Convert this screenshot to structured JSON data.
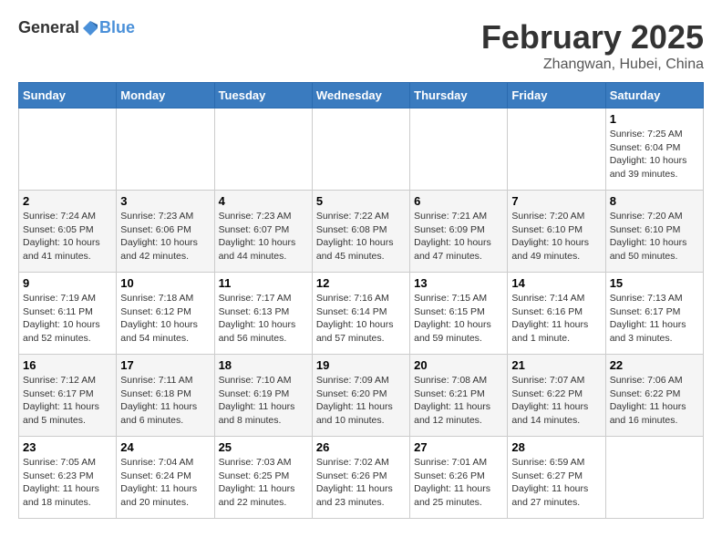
{
  "header": {
    "logo_general": "General",
    "logo_blue": "Blue",
    "month": "February 2025",
    "location": "Zhangwan, Hubei, China"
  },
  "days_of_week": [
    "Sunday",
    "Monday",
    "Tuesday",
    "Wednesday",
    "Thursday",
    "Friday",
    "Saturday"
  ],
  "weeks": [
    [
      {
        "day": "",
        "info": ""
      },
      {
        "day": "",
        "info": ""
      },
      {
        "day": "",
        "info": ""
      },
      {
        "day": "",
        "info": ""
      },
      {
        "day": "",
        "info": ""
      },
      {
        "day": "",
        "info": ""
      },
      {
        "day": "1",
        "info": "Sunrise: 7:25 AM\nSunset: 6:04 PM\nDaylight: 10 hours\nand 39 minutes."
      }
    ],
    [
      {
        "day": "2",
        "info": "Sunrise: 7:24 AM\nSunset: 6:05 PM\nDaylight: 10 hours\nand 41 minutes."
      },
      {
        "day": "3",
        "info": "Sunrise: 7:23 AM\nSunset: 6:06 PM\nDaylight: 10 hours\nand 42 minutes."
      },
      {
        "day": "4",
        "info": "Sunrise: 7:23 AM\nSunset: 6:07 PM\nDaylight: 10 hours\nand 44 minutes."
      },
      {
        "day": "5",
        "info": "Sunrise: 7:22 AM\nSunset: 6:08 PM\nDaylight: 10 hours\nand 45 minutes."
      },
      {
        "day": "6",
        "info": "Sunrise: 7:21 AM\nSunset: 6:09 PM\nDaylight: 10 hours\nand 47 minutes."
      },
      {
        "day": "7",
        "info": "Sunrise: 7:20 AM\nSunset: 6:10 PM\nDaylight: 10 hours\nand 49 minutes."
      },
      {
        "day": "8",
        "info": "Sunrise: 7:20 AM\nSunset: 6:10 PM\nDaylight: 10 hours\nand 50 minutes."
      }
    ],
    [
      {
        "day": "9",
        "info": "Sunrise: 7:19 AM\nSunset: 6:11 PM\nDaylight: 10 hours\nand 52 minutes."
      },
      {
        "day": "10",
        "info": "Sunrise: 7:18 AM\nSunset: 6:12 PM\nDaylight: 10 hours\nand 54 minutes."
      },
      {
        "day": "11",
        "info": "Sunrise: 7:17 AM\nSunset: 6:13 PM\nDaylight: 10 hours\nand 56 minutes."
      },
      {
        "day": "12",
        "info": "Sunrise: 7:16 AM\nSunset: 6:14 PM\nDaylight: 10 hours\nand 57 minutes."
      },
      {
        "day": "13",
        "info": "Sunrise: 7:15 AM\nSunset: 6:15 PM\nDaylight: 10 hours\nand 59 minutes."
      },
      {
        "day": "14",
        "info": "Sunrise: 7:14 AM\nSunset: 6:16 PM\nDaylight: 11 hours\nand 1 minute."
      },
      {
        "day": "15",
        "info": "Sunrise: 7:13 AM\nSunset: 6:17 PM\nDaylight: 11 hours\nand 3 minutes."
      }
    ],
    [
      {
        "day": "16",
        "info": "Sunrise: 7:12 AM\nSunset: 6:17 PM\nDaylight: 11 hours\nand 5 minutes."
      },
      {
        "day": "17",
        "info": "Sunrise: 7:11 AM\nSunset: 6:18 PM\nDaylight: 11 hours\nand 6 minutes."
      },
      {
        "day": "18",
        "info": "Sunrise: 7:10 AM\nSunset: 6:19 PM\nDaylight: 11 hours\nand 8 minutes."
      },
      {
        "day": "19",
        "info": "Sunrise: 7:09 AM\nSunset: 6:20 PM\nDaylight: 11 hours\nand 10 minutes."
      },
      {
        "day": "20",
        "info": "Sunrise: 7:08 AM\nSunset: 6:21 PM\nDaylight: 11 hours\nand 12 minutes."
      },
      {
        "day": "21",
        "info": "Sunrise: 7:07 AM\nSunset: 6:22 PM\nDaylight: 11 hours\nand 14 minutes."
      },
      {
        "day": "22",
        "info": "Sunrise: 7:06 AM\nSunset: 6:22 PM\nDaylight: 11 hours\nand 16 minutes."
      }
    ],
    [
      {
        "day": "23",
        "info": "Sunrise: 7:05 AM\nSunset: 6:23 PM\nDaylight: 11 hours\nand 18 minutes."
      },
      {
        "day": "24",
        "info": "Sunrise: 7:04 AM\nSunset: 6:24 PM\nDaylight: 11 hours\nand 20 minutes."
      },
      {
        "day": "25",
        "info": "Sunrise: 7:03 AM\nSunset: 6:25 PM\nDaylight: 11 hours\nand 22 minutes."
      },
      {
        "day": "26",
        "info": "Sunrise: 7:02 AM\nSunset: 6:26 PM\nDaylight: 11 hours\nand 23 minutes."
      },
      {
        "day": "27",
        "info": "Sunrise: 7:01 AM\nSunset: 6:26 PM\nDaylight: 11 hours\nand 25 minutes."
      },
      {
        "day": "28",
        "info": "Sunrise: 6:59 AM\nSunset: 6:27 PM\nDaylight: 11 hours\nand 27 minutes."
      },
      {
        "day": "",
        "info": ""
      }
    ]
  ]
}
